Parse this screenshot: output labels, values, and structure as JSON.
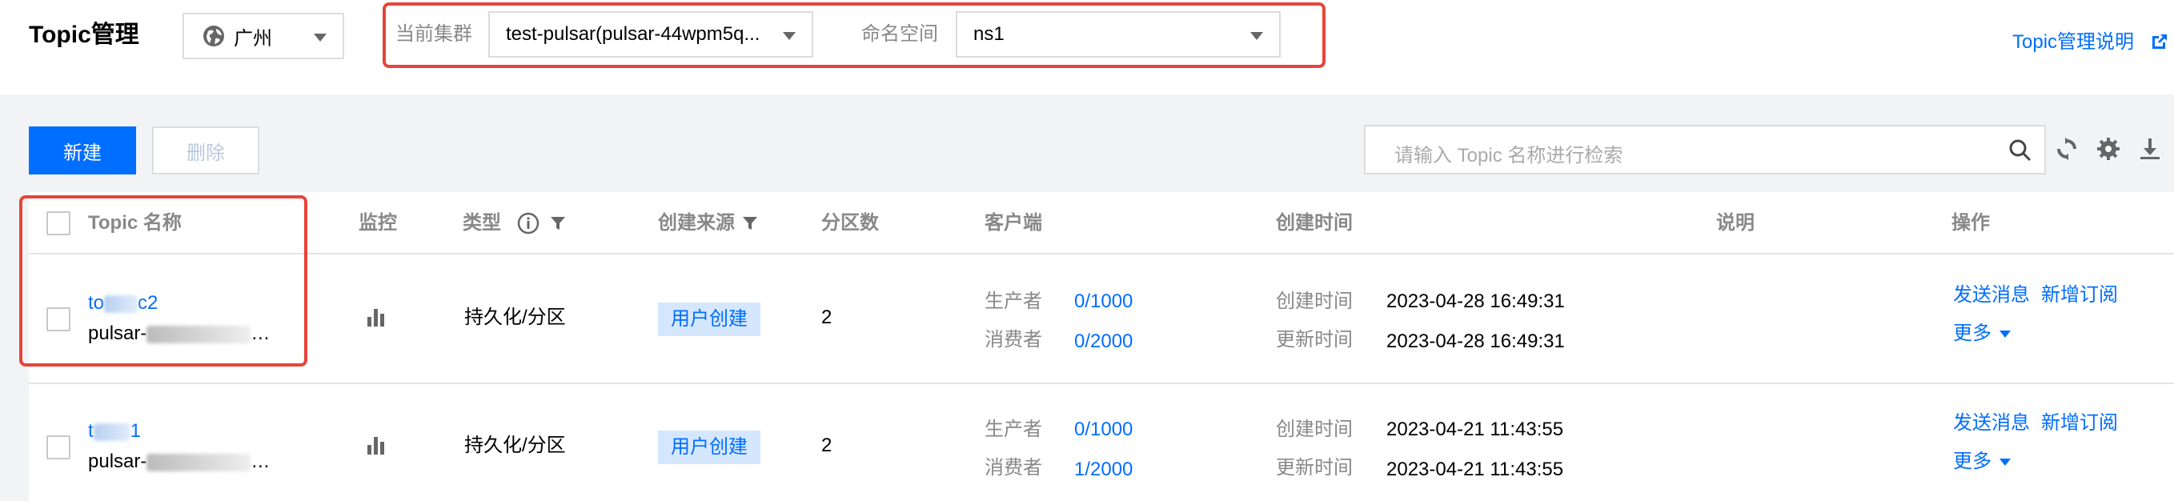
{
  "header": {
    "title": "Topic管理",
    "region": {
      "icon": "globe-icon",
      "value": "广州"
    },
    "cluster": {
      "label": "当前集群",
      "value": "test-pulsar(pulsar-44wpm5q..."
    },
    "namespace": {
      "label": "命名空间",
      "value": "ns1"
    },
    "help_link": "Topic管理说明",
    "help_icon": "external-link-icon"
  },
  "toolbar": {
    "new_label": "新建",
    "delete_label": "删除",
    "search_placeholder": "请输入 Topic 名称进行检索",
    "icons": [
      "search-icon",
      "refresh-icon",
      "gear-icon",
      "download-icon"
    ]
  },
  "table": {
    "columns": {
      "name": "Topic 名称",
      "monitor": "监控",
      "type": "类型",
      "source": "创建来源",
      "partitions": "分区数",
      "client": "客户端",
      "created": "创建时间",
      "description": "说明",
      "actions": "操作"
    },
    "rows": [
      {
        "name_prefix": "to",
        "name_suffix": "c2",
        "subname_prefix": "pulsar-",
        "subname_suffix": "…",
        "type": "持久化/分区",
        "source": "用户创建",
        "partitions": "2",
        "producer_label": "生产者",
        "producer_value": "0/1000",
        "consumer_label": "消费者",
        "consumer_value": "0/2000",
        "created_label": "创建时间",
        "created_value": "2023-04-28 16:49:31",
        "updated_label": "更新时间",
        "updated_value": "2023-04-28 16:49:31",
        "action_send": "发送消息",
        "action_subscribe": "新增订阅",
        "action_more": "更多"
      },
      {
        "name_prefix": "t",
        "name_suffix": "1",
        "subname_prefix": "pulsar-",
        "subname_suffix": "…",
        "type": "持久化/分区",
        "source": "用户创建",
        "partitions": "2",
        "producer_label": "生产者",
        "producer_value": "0/1000",
        "consumer_label": "消费者",
        "consumer_value": "1/2000",
        "created_label": "创建时间",
        "created_value": "2023-04-21 11:43:55",
        "updated_label": "更新时间",
        "updated_value": "2023-04-21 11:43:55",
        "action_send": "发送消息",
        "action_subscribe": "新增订阅",
        "action_more": "更多"
      }
    ]
  },
  "colors": {
    "accent": "#006eff",
    "highlight": "#e5453a",
    "tag_bg": "#d5e7ff"
  }
}
